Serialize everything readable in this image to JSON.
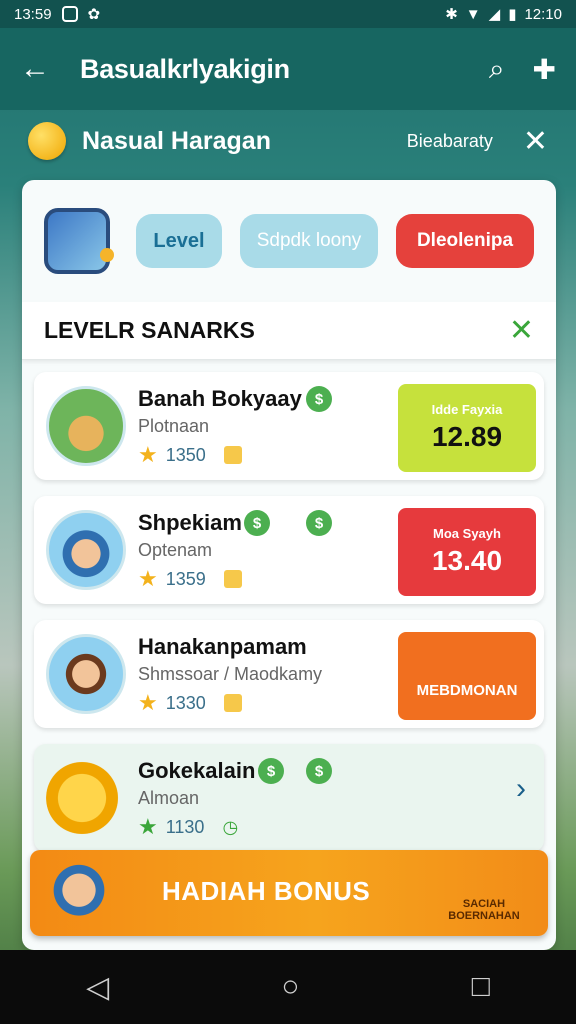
{
  "status_bar": {
    "time": "13:59",
    "right_time": "12:10"
  },
  "app_bar": {
    "title": "Basualkrlyakigin"
  },
  "subheader": {
    "title": "Nasual Haragan",
    "right_text": "Bieabaraty"
  },
  "filters": {
    "chip1": "Level",
    "chip2": "Sdpdk loony",
    "chip3": "Dleolenipa"
  },
  "section": {
    "title": "LEVELR SANARKS"
  },
  "items": [
    {
      "title": "Banah Bokyaay",
      "subtitle": "Plotnaan",
      "count": "1350",
      "price_caption": "Idde Fayxia",
      "price_value": "12.89"
    },
    {
      "title": "Shpekiam",
      "subtitle": "Optenam",
      "count": "1359",
      "price_caption": "Moa Syayh",
      "price_value": "13.40"
    },
    {
      "title": "Hanakanpamam",
      "subtitle": "Shmssoar / Maodkamy",
      "count": "1330",
      "promo": "MEBDMONAN"
    },
    {
      "title": "Gokekalain",
      "subtitle": "Almoan",
      "count": "1130"
    }
  ],
  "banner": {
    "title": "HADIAH BONUS",
    "side": "SACIAH BOERNAHAN"
  },
  "colors": {
    "primary": "#176661",
    "accent_red": "#e5413c",
    "accent_green": "#c6e13c",
    "accent_orange": "#f16f1f"
  }
}
